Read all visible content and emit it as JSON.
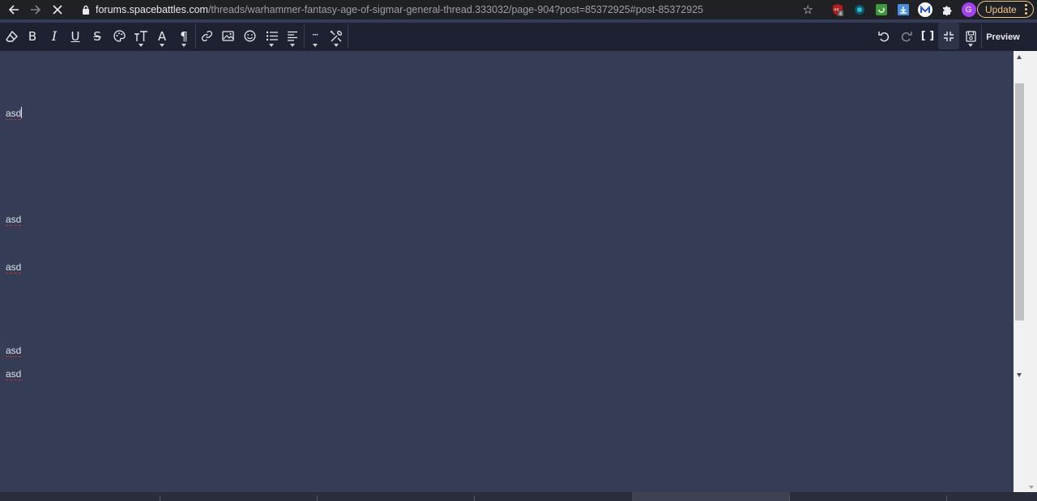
{
  "browser": {
    "url_host": "forums.spacebattles.com",
    "url_path": "/threads/warhammer-fantasy-age-of-sigmar-general-thread.333032/page-904?post=85372925#post-85372925",
    "back_icon": "arrow-left-icon",
    "forward_icon": "arrow-right-icon",
    "stop_icon": "close-icon",
    "extension_badge": "4",
    "profile_initial": "G",
    "update_label": "Update"
  },
  "toolbar": {
    "preview_label": "Preview",
    "more_label": "···"
  },
  "editor": {
    "lines": [
      {
        "text": "asd"
      },
      {
        "text": "asd"
      },
      {
        "text": "asd"
      },
      {
        "text": "asd"
      },
      {
        "text": "asd"
      }
    ]
  },
  "colors": {
    "chrome_bg": "#202124",
    "toolbar_bg": "#1e2131",
    "editor_bg": "#353c55",
    "update_accent": "#f3c98a",
    "profile_bg": "#a142f4"
  }
}
